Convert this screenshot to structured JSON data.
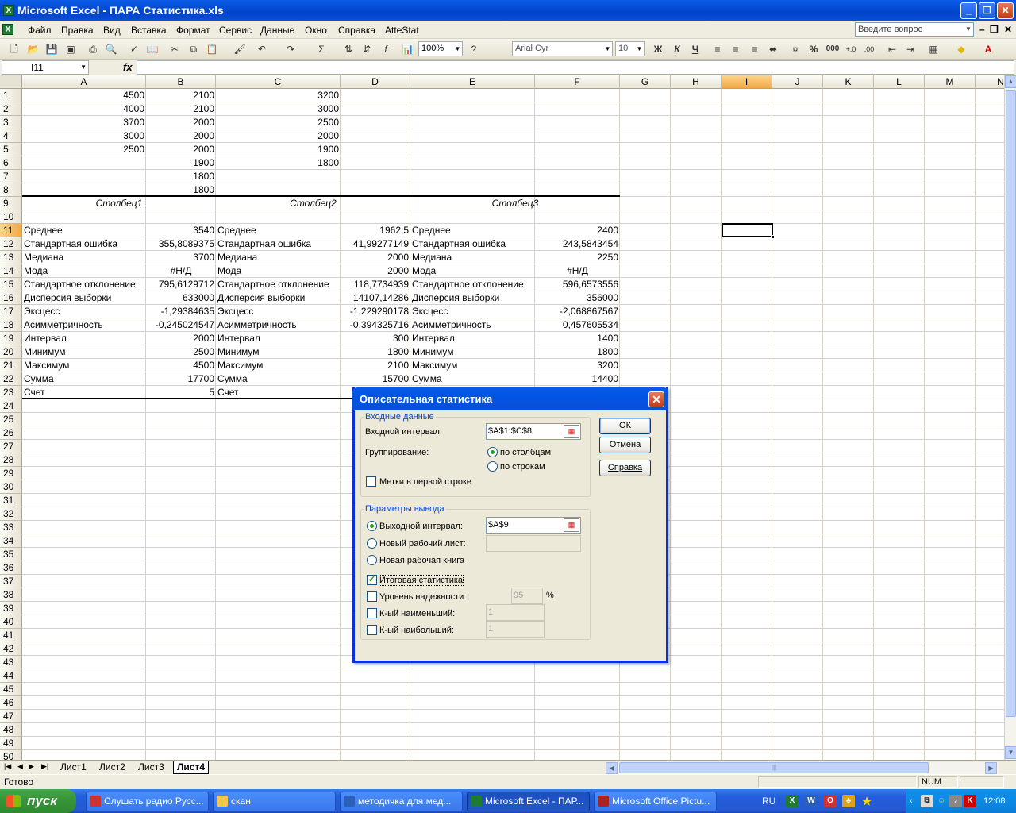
{
  "app": {
    "title": "Microsoft Excel - ПАРА Статистика.xls",
    "icon_glyph": "X"
  },
  "menu": {
    "items": [
      "Файл",
      "Правка",
      "Вид",
      "Вставка",
      "Формат",
      "Сервис",
      "Данные",
      "Окно",
      "Справка",
      "AtteStat"
    ],
    "ask_placeholder": "Введите вопрос"
  },
  "toolbar": {
    "zoom": "100%",
    "font_name": "Arial Cyr",
    "font_size": "10",
    "bold": "Ж",
    "italic": "К",
    "underline": "Ч",
    "percent": "%",
    "thousands": "000"
  },
  "formula_bar": {
    "name_box": "I11",
    "fx": "fx",
    "value": ""
  },
  "sheet": {
    "columns": [
      "A",
      "B",
      "C",
      "D",
      "E",
      "F",
      "G",
      "H",
      "I",
      "J",
      "K",
      "L",
      "M",
      "N"
    ],
    "selected_column": "I",
    "rows": [
      "1",
      "2",
      "3",
      "4",
      "5",
      "6",
      "7",
      "8",
      "9",
      "10",
      "11",
      "12",
      "13",
      "14",
      "15",
      "16",
      "17",
      "18",
      "19",
      "20",
      "21",
      "22",
      "23",
      "24",
      "25",
      "26",
      "27",
      "28",
      "29",
      "30",
      "31",
      "32",
      "33",
      "34",
      "35",
      "36",
      "37",
      "38",
      "39",
      "40",
      "41",
      "42",
      "43",
      "44",
      "45",
      "46",
      "47",
      "48",
      "49",
      "50"
    ],
    "selected_row": "11",
    "data": {
      "A1": "4500",
      "B1": "2100",
      "C1": "3200",
      "A2": "4000",
      "B2": "2100",
      "C2": "3000",
      "A3": "3700",
      "B3": "2000",
      "C3": "2500",
      "A4": "3000",
      "B4": "2000",
      "C4": "2000",
      "A5": "2500",
      "B5": "2000",
      "C5": "1900",
      "B6": "1900",
      "C6": "1800",
      "B7": "1800",
      "B8": "1800",
      "A9": "Столбец1",
      "C9": "Столбец2",
      "E9": "Столбец3",
      "A11": "Среднее",
      "B11": "3540",
      "C11": "Среднее",
      "D11": "1962,5",
      "E11": "Среднее",
      "F11": "2400",
      "A12": "Стандартная ошибка",
      "B12": "355,8089375",
      "C12": "Стандартная ошибка",
      "D12": "41,99277149",
      "E12": "Стандартная ошибка",
      "F12": "243,5843454",
      "A13": "Медиана",
      "B13": "3700",
      "C13": "Медиана",
      "D13": "2000",
      "E13": "Медиана",
      "F13": "2250",
      "A14": "Мода",
      "B14": "#Н/Д",
      "C14": "Мода",
      "D14": "2000",
      "E14": "Мода",
      "F14": "#Н/Д",
      "A15": "Стандартное отклонение",
      "B15": "795,6129712",
      "C15": "Стандартное отклонение",
      "D15": "118,7734939",
      "E15": "Стандартное отклонение",
      "F15": "596,6573556",
      "A16": "Дисперсия выборки",
      "B16": "633000",
      "C16": "Дисперсия выборки",
      "D16": "14107,14286",
      "E16": "Дисперсия выборки",
      "F16": "356000",
      "A17": "Эксцесс",
      "B17": "-1,29384635",
      "C17": "Эксцесс",
      "D17": "-1,229290178",
      "E17": "Эксцесс",
      "F17": "-2,068867567",
      "A18": "Асимметричность",
      "B18": "-0,245024547",
      "C18": "Асимметричность",
      "D18": "-0,394325716",
      "E18": "Асимметричность",
      "F18": "0,457605534",
      "A19": "Интервал",
      "B19": "2000",
      "C19": "Интервал",
      "D19": "300",
      "E19": "Интервал",
      "F19": "1400",
      "A20": "Минимум",
      "B20": "2500",
      "C20": "Минимум",
      "D20": "1800",
      "E20": "Минимум",
      "F20": "1800",
      "A21": "Максимум",
      "B21": "4500",
      "C21": "Максимум",
      "D21": "2100",
      "E21": "Максимум",
      "F21": "3200",
      "A22": "Сумма",
      "B22": "17700",
      "C22": "Сумма",
      "D22": "15700",
      "E22": "Сумма",
      "F22": "14400",
      "A23": "Счет",
      "B23": "5",
      "C23": "Счет"
    },
    "tabs": [
      "Лист1",
      "Лист2",
      "Лист3",
      "Лист4"
    ],
    "active_tab": "Лист4"
  },
  "status": {
    "ready": "Готово",
    "num": "NUM"
  },
  "dialog": {
    "title": "Описательная статистика",
    "input_group": "Входные данные",
    "input_range_label": "Входной интервал:",
    "input_range_value": "$A$1:$C$8",
    "grouping_label": "Группирование:",
    "by_columns": "по столбцам",
    "by_rows": "по строкам",
    "labels_first_row": "Метки в первой строке",
    "output_group": "Параметры вывода",
    "output_range_label": "Выходной интервал:",
    "output_range_value": "$A$9",
    "new_sheet": "Новый рабочий лист:",
    "new_book": "Новая рабочая книга",
    "summary_stats": "Итоговая статистика",
    "confidence": "Уровень надежности:",
    "confidence_value": "95",
    "percent": "%",
    "kth_smallest": "К-ый наименьший:",
    "kth_smallest_value": "1",
    "kth_largest": "К-ый наибольший:",
    "kth_largest_value": "1",
    "ok": "ОК",
    "cancel": "Отмена",
    "help": "Справка"
  },
  "taskbar": {
    "start": "пуск",
    "tasks": [
      "Слушать радио Русс...",
      "скан",
      "методичка для мед...",
      "Microsoft Excel - ПАР...",
      "Microsoft Office Pictu..."
    ],
    "active_task_index": 3,
    "lang": "RU",
    "clock": "12:08"
  }
}
